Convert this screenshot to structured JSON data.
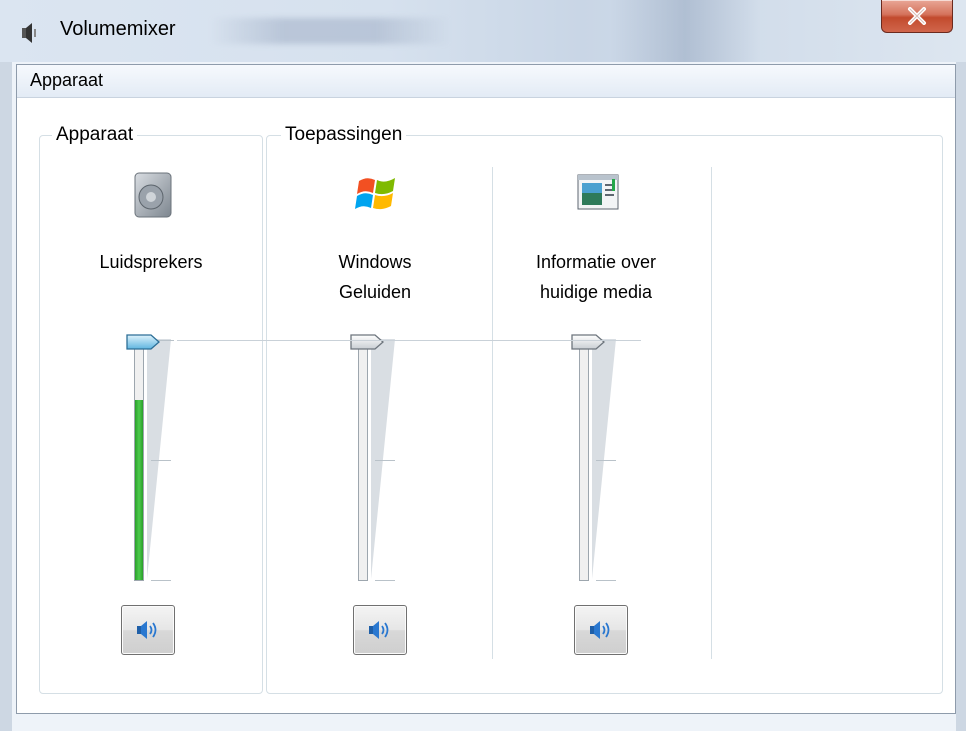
{
  "window": {
    "title": "Volumemixer",
    "icon": "speaker-icon",
    "close_icon": "close-icon"
  },
  "menu": {
    "items": [
      {
        "label": "Apparaat"
      }
    ]
  },
  "groups": {
    "device": {
      "label": "Apparaat"
    },
    "apps": {
      "label": "Toepassingen"
    }
  },
  "channels": [
    {
      "label": "Luidsprekers",
      "icon": "speakers-device-icon",
      "volume_percent": 100,
      "peak_percent": 75,
      "active": true
    },
    {
      "label": "Windows\nGeluiden",
      "icon": "windows-logo-icon",
      "volume_percent": 100,
      "peak_percent": 0,
      "active": false
    },
    {
      "label": "Informatie over\nhuidige media",
      "icon": "media-info-icon",
      "volume_percent": 100,
      "peak_percent": 0,
      "active": false
    }
  ],
  "colors": {
    "peak_meter": "#3cb83c",
    "thumb_active": "#7cc6ea",
    "close_button": "#c8553b"
  }
}
